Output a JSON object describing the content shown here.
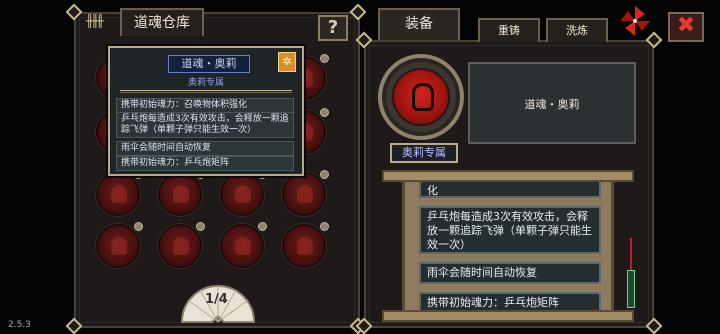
{
  "version": "2.5.3",
  "warehouse": {
    "tab_label": "道魂仓库",
    "help_label": "?",
    "page_label": "1/4"
  },
  "tooltip": {
    "title": "道魂・奥莉",
    "subtitle": "奥莉专属",
    "gem_icon": "star-gem-icon",
    "lines": [
      "携带初始魂力：召唤物体积强化",
      "乒乓炮每造成3次有效攻击，会释放一颗追踪飞弹（单颗子弹只能生效一次）",
      "雨伞会随时间自动恢复",
      "携带初始魂力：乒乓炮矩阵"
    ]
  },
  "equip": {
    "tab_equip": "装备",
    "tab_recast": "重铸",
    "tab_wash": "洗炼",
    "item_name": "道魂・奥莉",
    "exclusive_label": "奥莉专属",
    "scroll_items": [
      "化",
      "乒乓炮每造成3次有效攻击，会释放一颗追踪飞弹（单颗子弹只能生效一次）",
      "雨伞会随时间自动恢复",
      "携带初始魂力：乒乓炮矩阵"
    ]
  },
  "close_label": "✖",
  "colors": {
    "accent_red": "#c41f1f",
    "frame_gold": "#c9b98e",
    "tooltip_blue": "#14213b"
  }
}
